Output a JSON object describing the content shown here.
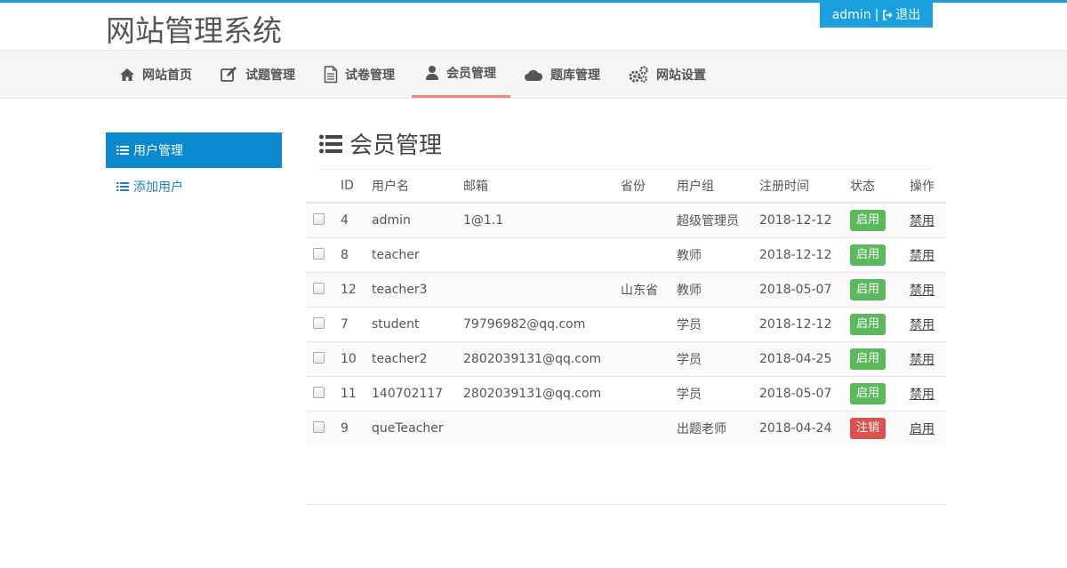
{
  "header": {
    "site_title": "网站管理系统",
    "user": "admin",
    "separator": "|",
    "logout": "退出"
  },
  "nav": [
    {
      "label": "网站首页",
      "icon": "home-icon"
    },
    {
      "label": "试题管理",
      "icon": "edit-icon"
    },
    {
      "label": "试卷管理",
      "icon": "document-icon"
    },
    {
      "label": "会员管理",
      "icon": "user-icon",
      "active": true
    },
    {
      "label": "题库管理",
      "icon": "cloud-icon"
    },
    {
      "label": "网站设置",
      "icon": "gears-icon"
    }
  ],
  "sidebar": {
    "items": [
      {
        "label": "用户管理",
        "icon": "list-icon",
        "active": true
      },
      {
        "label": "添加用户",
        "icon": "list-icon"
      }
    ]
  },
  "main": {
    "title": "会员管理",
    "columns": [
      "ID",
      "用户名",
      "邮箱",
      "省份",
      "用户组",
      "注册时间",
      "状态",
      "操作"
    ],
    "rows": [
      {
        "id": "4",
        "username": "admin",
        "email": "1@1.1",
        "province": "",
        "group": "超级管理员",
        "date": "2018-12-12",
        "status": "启用",
        "action": "禁用"
      },
      {
        "id": "8",
        "username": "teacher",
        "email": "",
        "province": "",
        "group": "教师",
        "date": "2018-12-12",
        "status": "启用",
        "action": "禁用"
      },
      {
        "id": "12",
        "username": "teacher3",
        "email": "",
        "province": "山东省",
        "group": "教师",
        "date": "2018-05-07",
        "status": "启用",
        "action": "禁用"
      },
      {
        "id": "7",
        "username": "student",
        "email": "79796982@qq.com",
        "province": "",
        "group": "学员",
        "date": "2018-12-12",
        "status": "启用",
        "action": "禁用"
      },
      {
        "id": "10",
        "username": "teacher2",
        "email": "2802039131@qq.com",
        "province": "",
        "group": "学员",
        "date": "2018-04-25",
        "status": "启用",
        "action": "禁用"
      },
      {
        "id": "11",
        "username": "140702117",
        "email": "2802039131@qq.com",
        "province": "",
        "group": "学员",
        "date": "2018-05-07",
        "status": "启用",
        "action": "禁用"
      },
      {
        "id": "9",
        "username": "queTeacher",
        "email": "",
        "province": "",
        "group": "出题老师",
        "date": "2018-04-24",
        "status": "注销",
        "action": "启用"
      }
    ]
  },
  "colors": {
    "accent": "#1aa0dc",
    "sidebar_active": "#0a89d0",
    "nav_active_underline": "#f08a72",
    "badge_enabled": "#5cb85c",
    "badge_cancelled": "#d9534f"
  }
}
